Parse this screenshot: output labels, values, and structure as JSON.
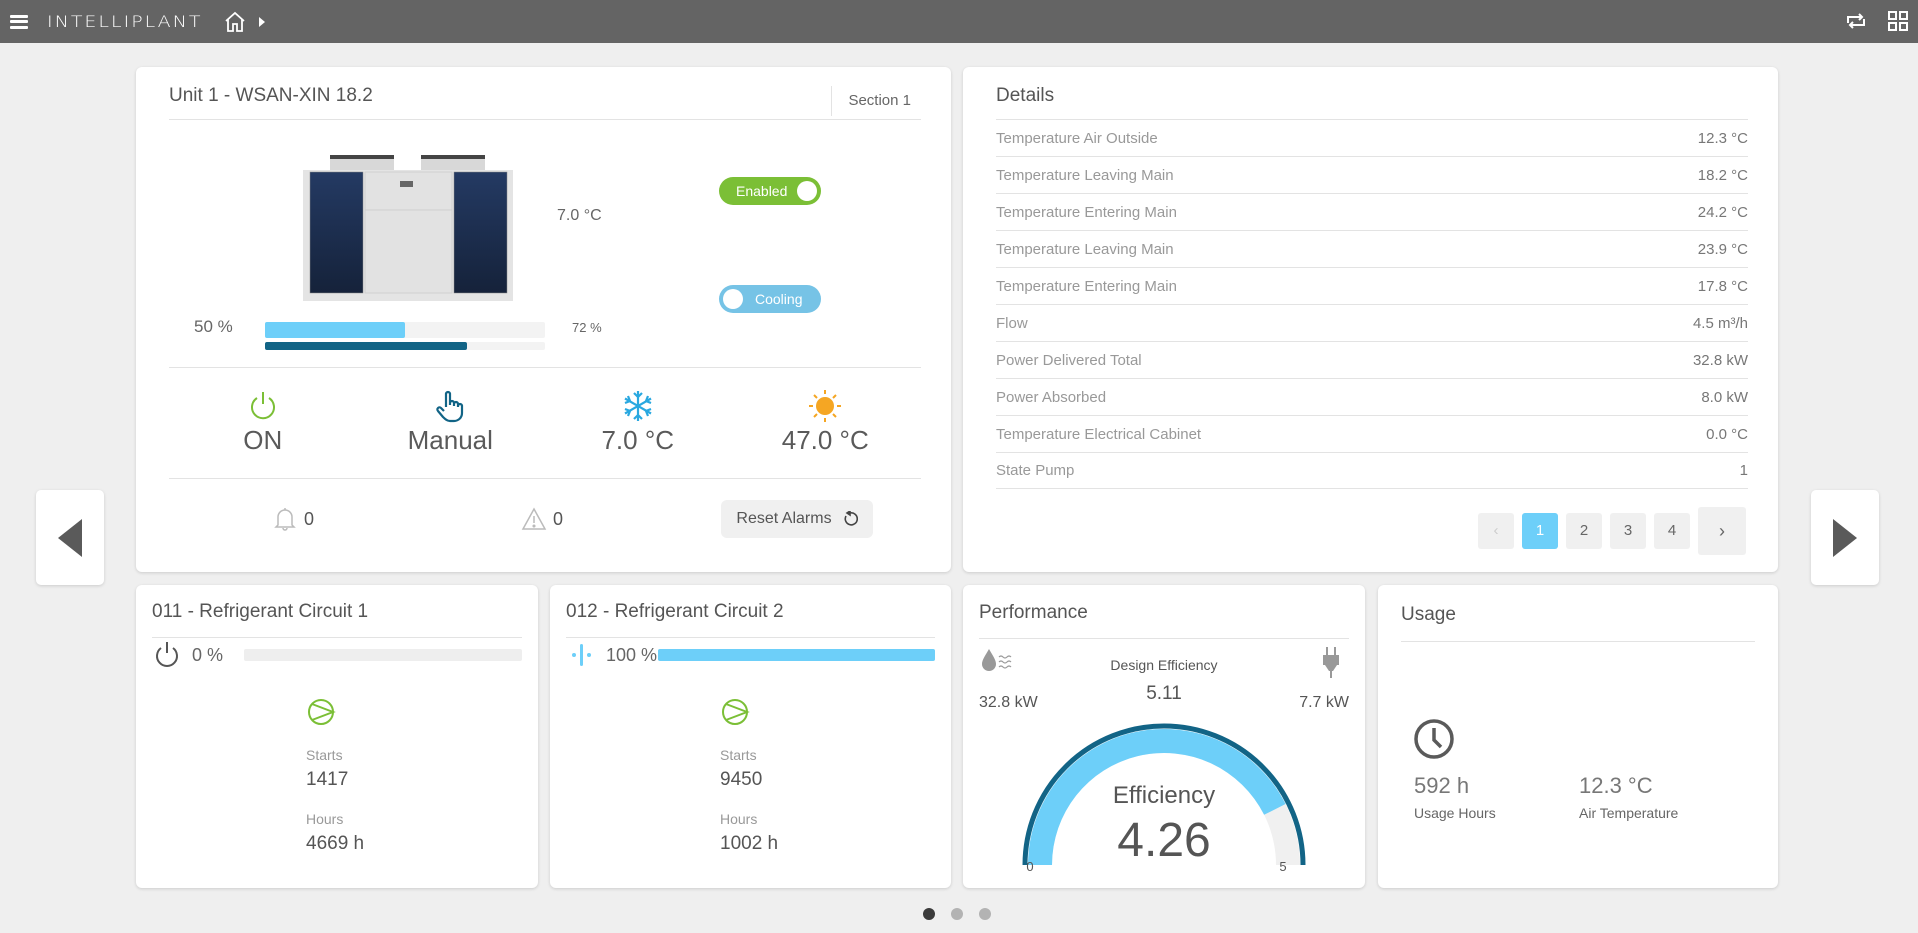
{
  "topbar": {
    "brand": "INTELLIPLANT",
    "icons": [
      "menu-icon",
      "home-icon",
      "breadcrumb-arrow-icon",
      "sync-icon",
      "grid-view-icon"
    ]
  },
  "unit": {
    "title": "Unit 1 - WSAN-XIN 18.2",
    "section": "Section 1",
    "setpoint_temp": "7.0 °C",
    "capacity_label": "50 %",
    "capacity_value": 0.5,
    "load_label": "72 %",
    "load_value": 0.72,
    "toggle_enabled": "Enabled",
    "toggle_mode": "Cooling",
    "status": [
      {
        "icon": "power-icon",
        "value": "ON"
      },
      {
        "icon": "hand-pointer-icon",
        "value": "Manual"
      },
      {
        "icon": "snowflake-icon",
        "value": "7.0 °C"
      },
      {
        "icon": "sun-icon",
        "value": "47.0 °C"
      }
    ],
    "alarms_count": "0",
    "warnings_count": "0",
    "reset_label": "Reset Alarms"
  },
  "details": {
    "title": "Details",
    "rows": [
      {
        "label": "Temperature Air Outside",
        "value": "12.3 °C"
      },
      {
        "label": "Temperature Leaving Main",
        "value": "18.2 °C"
      },
      {
        "label": "Temperature Entering Main",
        "value": "24.2 °C"
      },
      {
        "label": "Temperature Leaving Main",
        "value": "23.9 °C"
      },
      {
        "label": "Temperature Entering Main",
        "value": "17.8 °C"
      },
      {
        "label": "Flow",
        "value": "4.5 m³/h"
      },
      {
        "label": "Power Delivered Total",
        "value": "32.8 kW"
      },
      {
        "label": "Power Absorbed",
        "value": "8.0 kW"
      },
      {
        "label": "Temperature Electrical Cabinet",
        "value": "0.0 °C"
      },
      {
        "label": "State Pump",
        "value": "1"
      }
    ],
    "pager": {
      "prev": "‹",
      "pages": [
        "1",
        "2",
        "3",
        "4"
      ],
      "active": "1",
      "next": "›"
    }
  },
  "circuits": [
    {
      "title": "011 - Refrigerant Circuit 1",
      "pct_label": "0 %",
      "pct_value": 0.0,
      "starts_label": "Starts",
      "starts": "1417",
      "hours_label": "Hours",
      "hours": "4669 h"
    },
    {
      "title": "012 - Refrigerant Circuit 2",
      "pct_label": "100 %",
      "pct_value": 1.0,
      "starts_label": "Starts",
      "starts": "9450",
      "hours_label": "Hours",
      "hours": "1002 h"
    }
  ],
  "performance": {
    "title": "Performance",
    "delivered": "32.8 kW",
    "absorbed": "7.7 kW",
    "design_label": "Design Efficiency",
    "design_value": "5.11",
    "efficiency_label": "Efficiency",
    "efficiency_value": "4.26",
    "gauge_min": "0",
    "gauge_max": "5",
    "gauge_fraction": 0.852
  },
  "usage": {
    "title": "Usage",
    "hours": "592 h",
    "hours_label": "Usage Hours",
    "air_temp": "12.3 °C",
    "air_temp_label": "Air Temperature"
  },
  "carousel": {
    "pages": 3,
    "active": 0
  },
  "colors": {
    "topbar": "#646464",
    "accent_blue": "#6dcff9",
    "dark_blue": "#126486",
    "green": "#7bbf36",
    "cooling_toggle": "#76c3e6",
    "snowflake": "#29a8e0",
    "sun": "#f5a623"
  }
}
